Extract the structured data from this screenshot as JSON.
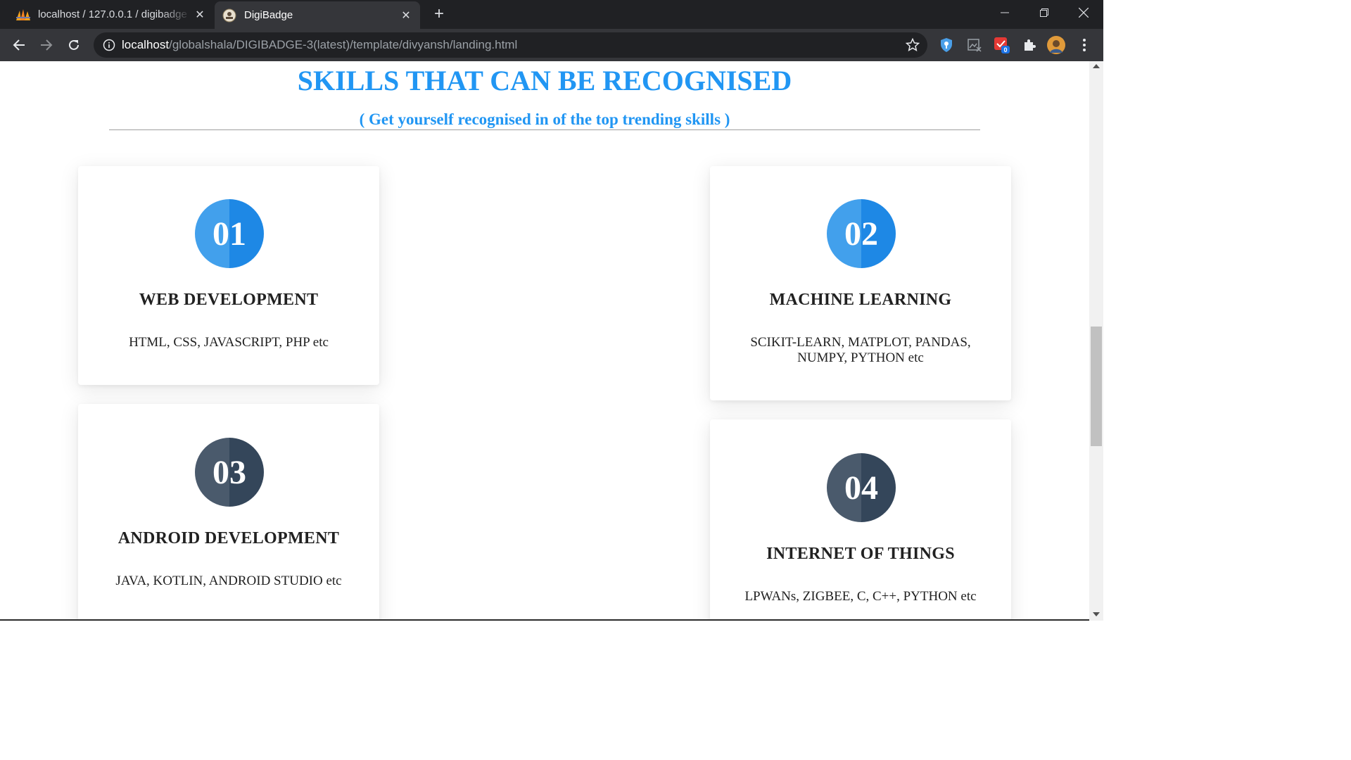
{
  "browser": {
    "tabs": [
      {
        "title": "localhost / 127.0.0.1 / digibadge",
        "active": false
      },
      {
        "title": "DigiBadge",
        "active": true
      }
    ],
    "url_host": "localhost",
    "url_path": "/globalshala/DIGIBADGE-3(latest)/template/divyansh/landing.html",
    "extension_badge": "0"
  },
  "page": {
    "heading": "SKILLS THAT CAN BE RECOGNISED",
    "subheading": "( Get yourself recognised in of the top trending skills )",
    "cards": [
      {
        "number": "01",
        "title": "WEB DEVELOPMENT",
        "skills": "HTML, CSS, JAVASCRIPT, PHP etc",
        "color": "blue"
      },
      {
        "number": "02",
        "title": "MACHINE LEARNING",
        "skills": "SCIKIT-LEARN, MATPLOT, PANDAS, NUMPY, PYTHON etc",
        "color": "blue"
      },
      {
        "number": "03",
        "title": "ANDROID DEVELOPMENT",
        "skills": "JAVA, KOTLIN, ANDROID STUDIO etc",
        "color": "dark"
      },
      {
        "number": "04",
        "title": "INTERNET OF THINGS",
        "skills": "LPWANs, ZIGBEE, C, C++, PYTHON etc",
        "color": "dark"
      }
    ]
  },
  "colors": {
    "accent": "#2196f3",
    "circle_blue": "#1e88e5",
    "circle_dark": "#34465a",
    "text": "#212121"
  }
}
